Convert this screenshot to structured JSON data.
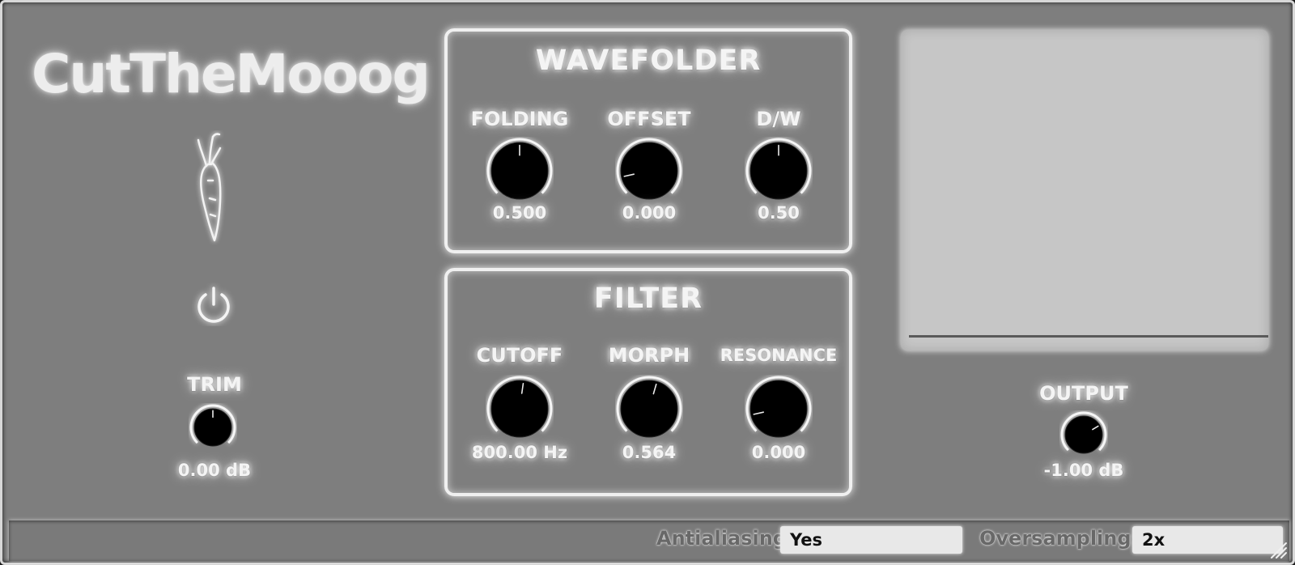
{
  "app": {
    "title": "CutTheMooog"
  },
  "wavefolder": {
    "title": "WAVEFOLDER",
    "knobs": [
      {
        "label": "FOLDING",
        "value": "0.500",
        "level": 0.5
      },
      {
        "label": "OFFSET",
        "value": "0.000",
        "level": 0.12
      },
      {
        "label": "D/W",
        "value": "0.50",
        "level": 0.5
      }
    ]
  },
  "filter": {
    "title": "FILTER",
    "knobs": [
      {
        "label": "CUTOFF",
        "value": "800.00 Hz",
        "level": 0.53
      },
      {
        "label": "MORPH",
        "value": "0.564",
        "level": 0.56
      },
      {
        "label": "RESONANCE",
        "value": "0.000",
        "level": 0.12
      }
    ]
  },
  "trim": {
    "label": "TRIM",
    "value": "0.00 dB",
    "level": 0.5
  },
  "output": {
    "label": "OUTPUT",
    "value": "-1.00 dB",
    "level": 0.72
  },
  "footer": {
    "antialiasing_label": "Antialiasing",
    "antialiasing_value": "Yes",
    "oversampling_label": "Oversampling:",
    "oversampling_value": "2x"
  },
  "icons": {
    "logo": "carrot-icon",
    "power": "power-icon",
    "resize": "resize-grip-icon"
  }
}
